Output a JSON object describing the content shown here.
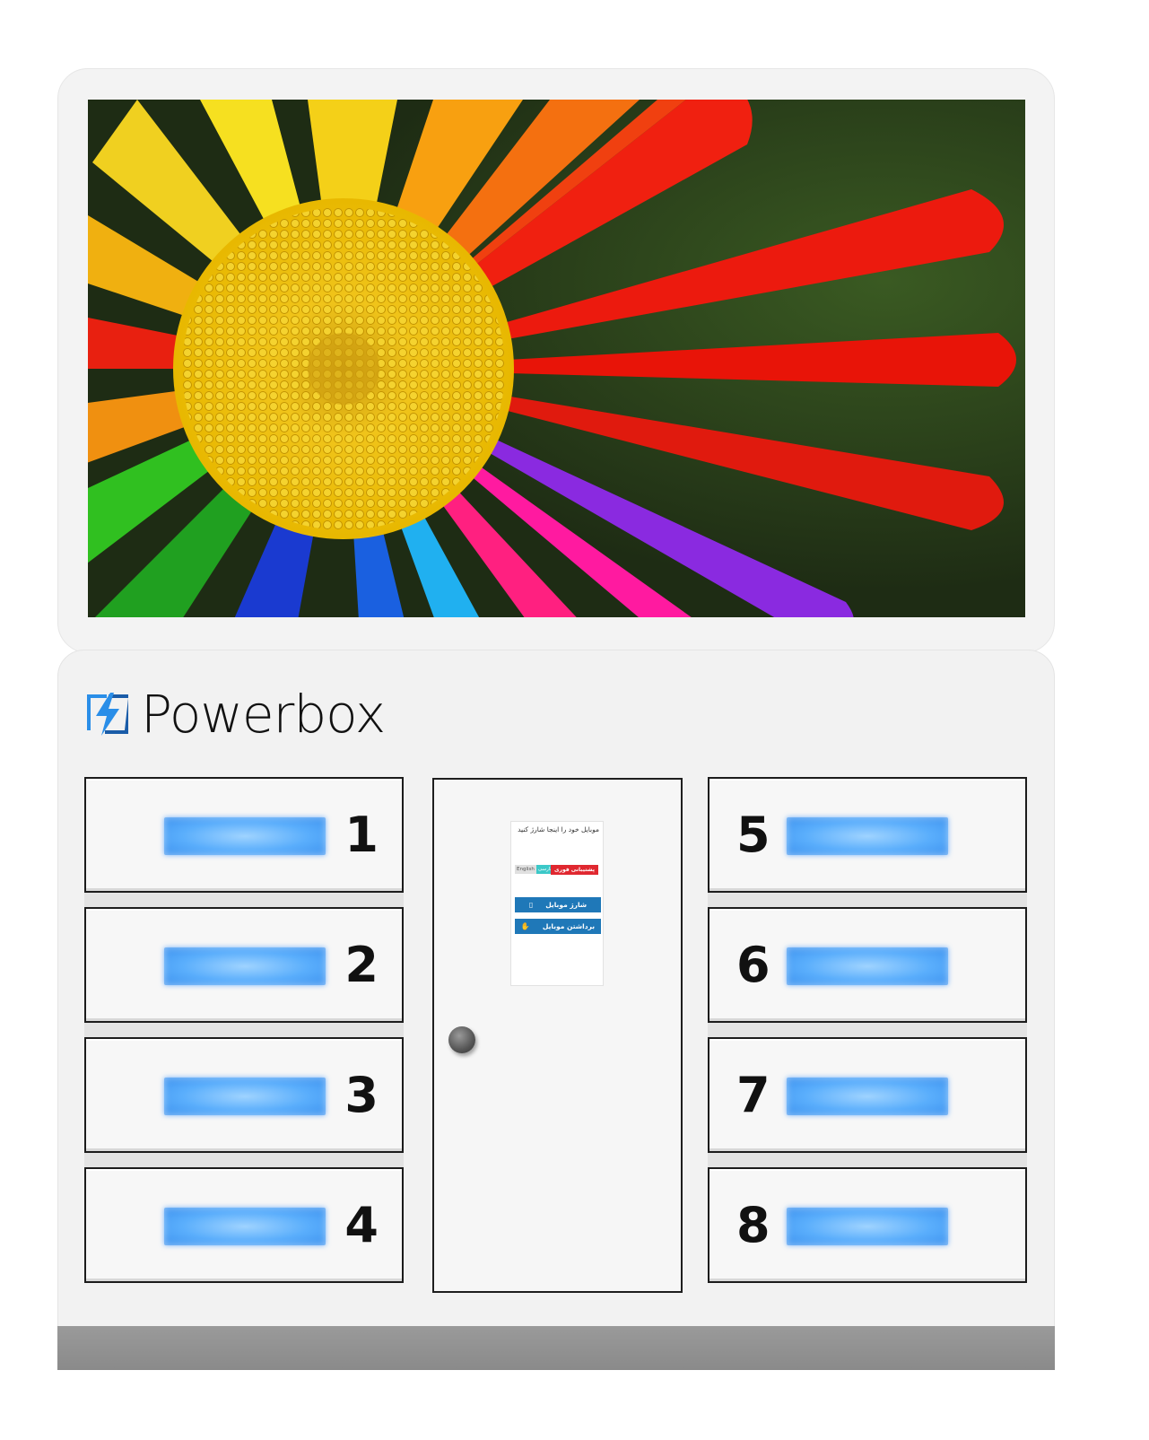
{
  "brand": {
    "name": "Powerbox",
    "accent": "#2a8ee8"
  },
  "screen": {
    "image": "rainbow-daisy-flower"
  },
  "kiosk": {
    "title": "موبایل خود را اینجا شارژ کنید",
    "lang_en": "English",
    "lang_fa": "فارسی",
    "support": "پشتیبانی فوری",
    "btn_charge": "شارژ موبایل",
    "btn_charge_icon": "phone-charge-icon",
    "btn_pickup": "برداشتن موبایل",
    "btn_pickup_icon": "hand-pickup-icon"
  },
  "lockers": {
    "left": [
      {
        "num": "1"
      },
      {
        "num": "2"
      },
      {
        "num": "3"
      },
      {
        "num": "4"
      }
    ],
    "right": [
      {
        "num": "5"
      },
      {
        "num": "6"
      },
      {
        "num": "7"
      },
      {
        "num": "8"
      }
    ],
    "led_color": "#5aaefc"
  }
}
